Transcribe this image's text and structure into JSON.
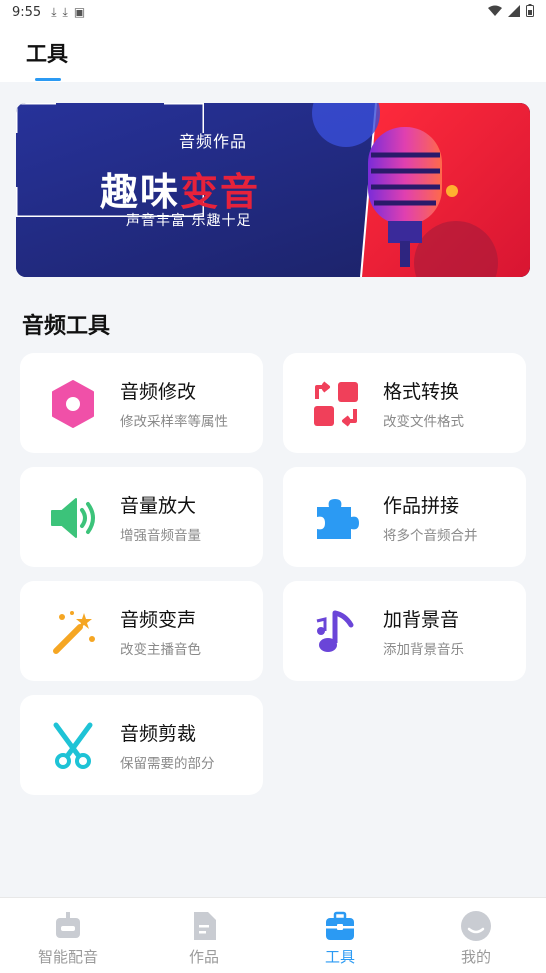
{
  "status_bar": {
    "time": "9:55"
  },
  "header": {
    "title": "工具"
  },
  "banner": {
    "kicker": "音频作品",
    "title_part1": "趣味",
    "title_part2": "变音",
    "subtitle": "声音丰富 乐趣十足"
  },
  "section": {
    "title": "音频工具"
  },
  "tools": [
    {
      "name": "音频修改",
      "desc": "修改采样率等属性",
      "icon": "hexagon-record-icon",
      "color": "#f050a8"
    },
    {
      "name": "格式转换",
      "desc": "改变文件格式",
      "icon": "convert-squares-icon",
      "color": "#f0405a"
    },
    {
      "name": "音量放大",
      "desc": "增强音频音量",
      "icon": "speaker-volume-icon",
      "color": "#3cc37a"
    },
    {
      "name": "作品拼接",
      "desc": "将多个音频合并",
      "icon": "puzzle-piece-icon",
      "color": "#2b9af3"
    },
    {
      "name": "音频变声",
      "desc": "改变主播音色",
      "icon": "magic-wand-icon",
      "color": "#f5a623"
    },
    {
      "name": "加背景音",
      "desc": "添加背景音乐",
      "icon": "music-note-icon",
      "color": "#6a45d8"
    },
    {
      "name": "音频剪裁",
      "desc": "保留需要的部分",
      "icon": "scissors-icon",
      "color": "#1ec3d6"
    }
  ],
  "bottom_nav": [
    {
      "label": "智能配音",
      "icon": "robot-icon",
      "active": false
    },
    {
      "label": "作品",
      "icon": "document-icon",
      "active": false
    },
    {
      "label": "工具",
      "icon": "toolbox-icon",
      "active": true
    },
    {
      "label": "我的",
      "icon": "smiley-face-icon",
      "active": false
    }
  ]
}
